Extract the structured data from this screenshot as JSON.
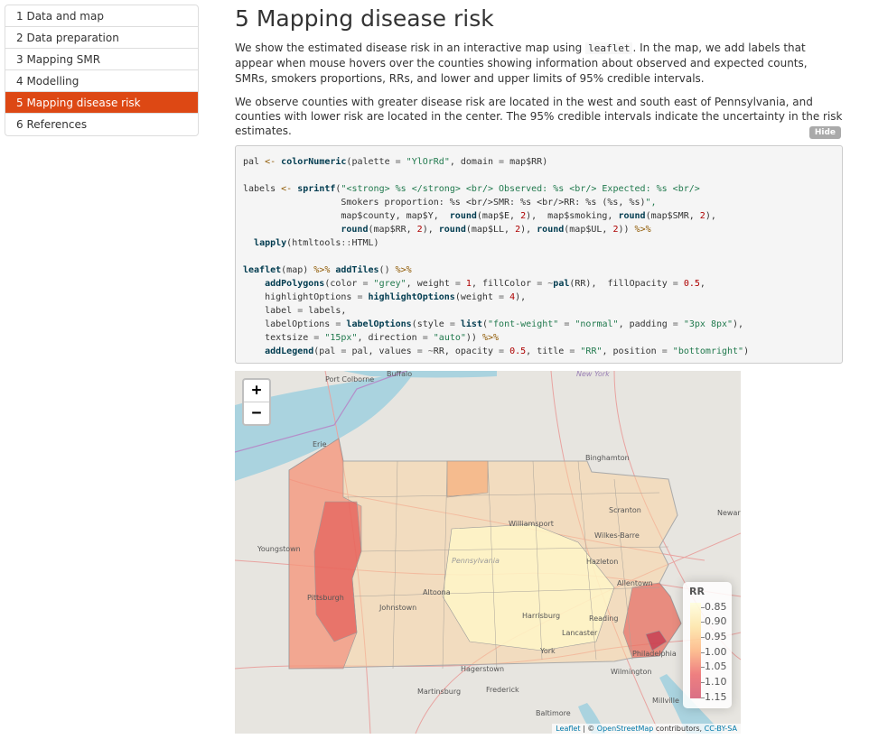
{
  "toc": {
    "items": [
      {
        "label": "1 Data and map"
      },
      {
        "label": "2 Data preparation"
      },
      {
        "label": "3 Mapping SMR"
      },
      {
        "label": "4 Modelling"
      },
      {
        "label": "5 Mapping disease risk"
      },
      {
        "label": "6 References"
      }
    ],
    "active_index": 4
  },
  "page": {
    "title": "5 Mapping disease risk",
    "para1_a": "We show the estimated disease risk in an interactive map using",
    "para1_code": "leaflet",
    "para1_b": ". In the map, we add labels that appear when mouse hovers over the counties showing information about observed and expected counts, SMRs, smokers proportions, RRs, and lower and upper limits of 95% credible intervals.",
    "para2": "We observe counties with greater disease risk are located in the west and south east of Pennsylvania, and counties with lower risk are located in the center. The 95% credible intervals indicate the uncertainty in the risk estimates.",
    "hide_label": "Hide"
  },
  "code": {
    "lines": [
      "pal <- colorNumeric(palette = \"YlOrRd\", domain = map$RR)",
      "",
      "labels <- sprintf(\"<strong> %s </strong> <br/> Observed: %s <br/> Expected: %s <br/>",
      "                  Smokers proportion: %s <br/>SMR: %s <br/>RR: %s (%s, %s)\",",
      "                  map$county, map$Y,  round(map$E, 2),  map$smoking, round(map$SMR, 2),",
      "                  round(map$RR, 2), round(map$LL, 2), round(map$UL, 2)) %>%",
      "  lapply(htmltools::HTML)",
      "",
      "leaflet(map) %>% addTiles() %>%",
      "    addPolygons(color = \"grey\", weight = 1, fillColor = ~pal(RR),  fillOpacity = 0.5,",
      "    highlightOptions = highlightOptions(weight = 4),",
      "    label = labels,",
      "    labelOptions = labelOptions(style = list(\"font-weight\" = \"normal\", padding = \"3px 8px\"),",
      "    textsize = \"15px\", direction = \"auto\")) %>%",
      "    addLegend(pal = pal, values = ~RR, opacity = 0.5, title = \"RR\", position = \"bottomright\")"
    ]
  },
  "map": {
    "zoom_in": "+",
    "zoom_out": "−",
    "cities": [
      {
        "name": "Buffalo"
      },
      {
        "name": "Port Colborne"
      },
      {
        "name": "New York"
      },
      {
        "name": "Erie"
      },
      {
        "name": "Binghamton"
      },
      {
        "name": "Scranton"
      },
      {
        "name": "Williamsport"
      },
      {
        "name": "Wilkes-Barre"
      },
      {
        "name": "Hazleton"
      },
      {
        "name": "Youngstown"
      },
      {
        "name": "Pennsylvania"
      },
      {
        "name": "Altoona"
      },
      {
        "name": "Allentown"
      },
      {
        "name": "Pittsburgh"
      },
      {
        "name": "Johnstown"
      },
      {
        "name": "Harrisburg"
      },
      {
        "name": "Reading"
      },
      {
        "name": "Lancaster"
      },
      {
        "name": "Philadelphia"
      },
      {
        "name": "York"
      },
      {
        "name": "Hagerstown"
      },
      {
        "name": "Wilmington"
      },
      {
        "name": "Frederick"
      },
      {
        "name": "Martinsburg"
      },
      {
        "name": "Baltimore"
      },
      {
        "name": "Millville"
      },
      {
        "name": "Newark"
      }
    ],
    "legend": {
      "title": "RR",
      "labels": [
        "0.85",
        "0.90",
        "0.95",
        "1.00",
        "1.05",
        "1.10",
        "1.15"
      ],
      "palette": [
        "#ffffcc",
        "#fed976",
        "#fd8d3c",
        "#e31a1c",
        "#bd0026"
      ]
    },
    "attribution": {
      "leaflet": "Leaflet",
      "sep": " | © ",
      "osm": "OpenStreetMap",
      "contrib": " contributors, ",
      "license": "CC-BY-SA"
    }
  }
}
